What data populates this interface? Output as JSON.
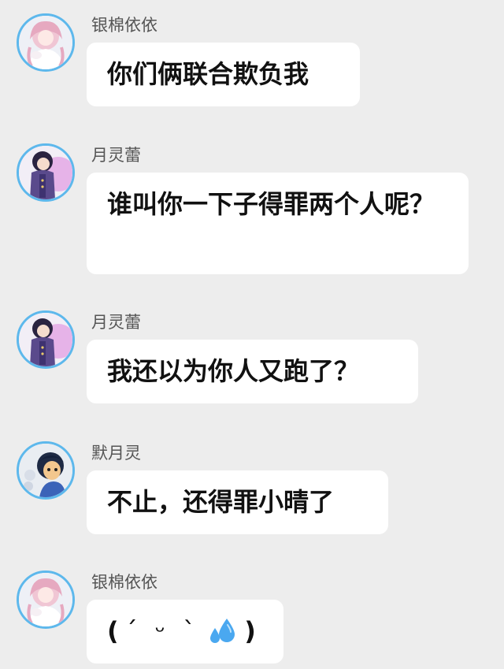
{
  "messages": [
    {
      "sender": "银棉依依",
      "avatar_icon": "pink-haired-girl-avatar-icon",
      "text": "你们俩联合欺负我"
    },
    {
      "sender": "月灵蕾",
      "avatar_icon": "purple-coat-girl-avatar-icon",
      "text": "谁叫你一下子得罪两个人呢？"
    },
    {
      "sender": "月灵蕾",
      "avatar_icon": "purple-coat-girl-avatar-icon",
      "text": "我还以为你人又跑了？"
    },
    {
      "sender": "默月灵",
      "avatar_icon": "dark-haired-boy-avatar-icon",
      "text": "不止，还得罪小晴了"
    },
    {
      "sender": "银棉依依",
      "avatar_icon": "pink-haired-girl-avatar-icon",
      "emoticon": {
        "open": "(",
        "face": "´ ᵕ `",
        "emoji_icon": "sweat-droplets-icon",
        "close": ")"
      }
    }
  ],
  "colors": {
    "background": "#ededed",
    "bubble": "#ffffff",
    "avatar_border": "#5db8ec",
    "sender_name": "#555555",
    "message_text": "#111111",
    "sweat_blue": "#4aa8f0"
  }
}
